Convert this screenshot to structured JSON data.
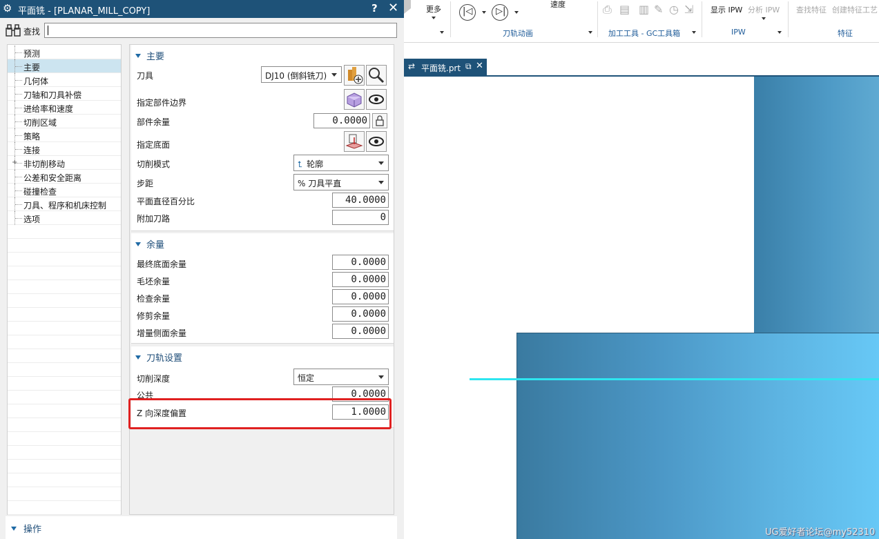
{
  "dialog": {
    "title": "平面铣 - [PLANAR_MILL_COPY]",
    "help": "?",
    "close": "✕",
    "find_label": "查找",
    "find_value": ""
  },
  "tree": {
    "items": [
      {
        "label": "预测"
      },
      {
        "label": "主要",
        "selected": true
      },
      {
        "label": "几何体"
      },
      {
        "label": "刀轴和刀具补偿"
      },
      {
        "label": "进给率和速度"
      },
      {
        "label": "切削区域"
      },
      {
        "label": "策略"
      },
      {
        "label": "连接"
      },
      {
        "label": "非切削移动",
        "expandable": true
      },
      {
        "label": "公差和安全距离"
      },
      {
        "label": "碰撞检查"
      },
      {
        "label": "刀具、程序和机床控制"
      },
      {
        "label": "选项"
      }
    ]
  },
  "main_section": {
    "title": "主要",
    "tool_label": "刀具",
    "tool_value": "DJ10 (倒斜铣刀)",
    "part_boundary_label": "指定部件边界",
    "part_stock_label": "部件余量",
    "part_stock_value": "0.0000",
    "floor_label": "指定底面",
    "cut_pattern_label": "切削模式",
    "cut_pattern_value": "轮廓",
    "stepover_label": "步距",
    "stepover_value": "% 刀具平直",
    "flat_pct_label": "平面直径百分比",
    "flat_pct_value": "40.0000",
    "extra_passes_label": "附加刀路",
    "extra_passes_value": "0"
  },
  "stock_section": {
    "title": "余量",
    "rows": [
      {
        "label": "最终底面余量",
        "value": "0.0000"
      },
      {
        "label": "毛坯余量",
        "value": "0.0000"
      },
      {
        "label": "检查余量",
        "value": "0.0000"
      },
      {
        "label": "修剪余量",
        "value": "0.0000"
      },
      {
        "label": "增量侧面余量",
        "value": "0.0000"
      }
    ]
  },
  "path_section": {
    "title": "刀轨设置",
    "depth_label": "切削深度",
    "depth_value": "恒定",
    "tolerance_label": "公共",
    "tolerance_value": "0.0000",
    "z_offset_label": "Z 向深度偏置",
    "z_offset_value": "1.0000"
  },
  "operations": {
    "title": "操作"
  },
  "ribbon": {
    "more": "更多",
    "speed": "速度",
    "toolpath_anim": "刀轨动画",
    "machining_tools": "加工工具 - GC工具箱",
    "show_ipw": "显示 IPW",
    "analyze_ipw": "分析 IPW",
    "ipw": "IPW",
    "find_feature": "查找特征",
    "create_feature_process": "创建特征工艺",
    "feature": "特征"
  },
  "tab": {
    "label": "平面铣.prt"
  },
  "watermark": "UG爱好者论坛@my52310",
  "colors": {
    "titlebar": "#1e5278",
    "highlight": "#e02020",
    "toolpath": "#2ee6f0",
    "solid": "#4c98c7"
  }
}
